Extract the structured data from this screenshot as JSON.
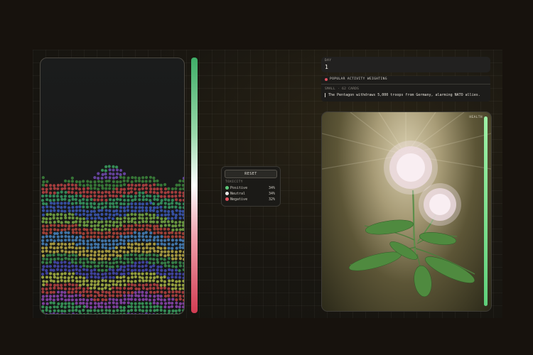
{
  "controls": {
    "reset_label": "RESET",
    "toxicity_title": "TOXICITY",
    "rows": [
      {
        "label": "Positive",
        "pct": "34%",
        "color": "#5dc97a"
      },
      {
        "label": "Neutral",
        "pct": "34%",
        "color": "#e8e8e8"
      },
      {
        "label": "Negative",
        "pct": "32%",
        "color": "#e0505e"
      }
    ]
  },
  "day": {
    "label": "DAY",
    "value": "1"
  },
  "news": {
    "header": "POPULAR ACTIVITY WEIGHTING",
    "meta": "SMALL · 62 CARDS",
    "headline": "The Pentagon withdraws 5,000 troops from Germany, alarming NATO allies."
  },
  "plant": {
    "health_label": "HEALTH",
    "health_level": 1.0
  },
  "colors": {
    "positive": "#3fae68",
    "negative": "#d23c52",
    "accent_green": "#5fd07a"
  },
  "icons": {
    "live_dot": "live-dot-icon",
    "plant": "mimosa-plant-illustration"
  }
}
